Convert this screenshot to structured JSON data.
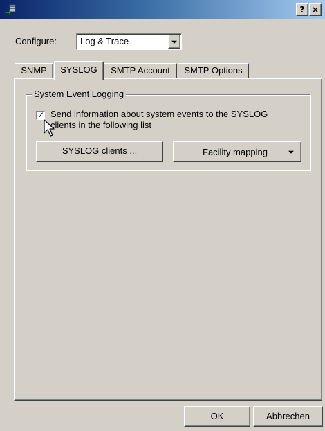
{
  "titlebar": {
    "help_label": "?",
    "close_label": "×",
    "icon": "network-app-icon"
  },
  "configure": {
    "label": "Configure:",
    "value": "Log & Trace"
  },
  "tabs": [
    {
      "label": "SNMP",
      "active": false
    },
    {
      "label": "SYSLOG",
      "active": true
    },
    {
      "label": "SMTP Account",
      "active": false
    },
    {
      "label": "SMTP Options",
      "active": false
    }
  ],
  "syslog": {
    "group_title": "System Event Logging",
    "checkbox_label": "Send information about system events to the SYSLOG clients in the following list",
    "checkbox_checked": true,
    "check_glyph": "✓",
    "clients_button": "SYSLOG clients ...",
    "facility_button": "Facility mapping"
  },
  "footer": {
    "ok_label": "OK",
    "cancel_label": "Abbrechen"
  },
  "colors": {
    "face": "#d4d0c8",
    "titlebar_start": "#0a246a",
    "titlebar_end": "#a6caf0"
  }
}
